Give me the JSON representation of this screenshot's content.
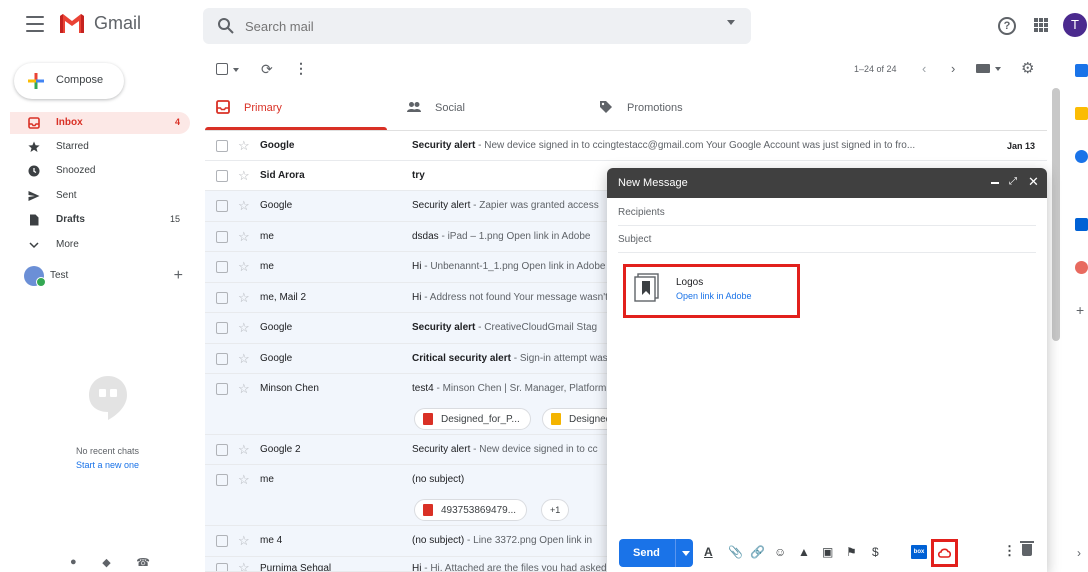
{
  "app": {
    "name": "Gmail",
    "avatar_letter": "T",
    "accent": "#d93025",
    "brand_blue": "#1a73e8"
  },
  "search": {
    "placeholder": "Search mail"
  },
  "sidebar": {
    "compose_label": "Compose",
    "items": [
      {
        "label": "Inbox",
        "count": "4",
        "icon": "inbox-icon",
        "active": true
      },
      {
        "label": "Starred",
        "count": "",
        "icon": "star-icon"
      },
      {
        "label": "Snoozed",
        "count": "",
        "icon": "clock-icon"
      },
      {
        "label": "Sent",
        "count": "",
        "icon": "send-icon"
      },
      {
        "label": "Drafts",
        "count": "15",
        "icon": "draft-icon"
      },
      {
        "label": "More",
        "count": "",
        "icon": "chevron-down-icon"
      }
    ],
    "account_label": "Test",
    "no_chats": "No recent chats",
    "start_new": "Start a new one"
  },
  "toolbar": {
    "page_count": "1–24 of 24"
  },
  "tabs": [
    {
      "label": "Primary",
      "icon": "inbox-icon"
    },
    {
      "label": "Social",
      "icon": "people-icon"
    },
    {
      "label": "Promotions",
      "icon": "tag-icon"
    }
  ],
  "emails": [
    {
      "sender": "Google",
      "subject": "Security alert",
      "snippet": " - New device signed in to ccingtestacc@gmail.com Your Google Account was just signed in to fro...",
      "date": "Jan 13",
      "unread": true
    },
    {
      "sender": "Sid Arora",
      "subject": "try",
      "snippet": "",
      "date": "",
      "unread": true
    },
    {
      "sender": "Google",
      "subject": "Security alert",
      "snippet": " - Zapier was granted access",
      "date": "",
      "unread": false
    },
    {
      "sender": "me",
      "subject": "dsdas",
      "snippet": " - iPad – 1.png Open link in Adobe",
      "date": "",
      "unread": false
    },
    {
      "sender": "me",
      "subject": "Hi",
      "snippet": " - Unbenannt-1_1.png Open link in Adobe",
      "date": "",
      "unread": false
    },
    {
      "sender": "me, Mail 2",
      "subject": "Hi",
      "snippet": " - Address not found Your message wasn't",
      "date": "",
      "unread": false
    },
    {
      "sender": "Google",
      "subject": "Security alert",
      "snippet": " - CreativeCloudGmail Stag",
      "date": "",
      "unread": false
    },
    {
      "sender": "Google",
      "subject": "Critical security alert",
      "snippet": " - Sign-in attempt was",
      "date": "",
      "unread": false
    },
    {
      "sender": "Minson Chen",
      "subject": "test4",
      "snippet": " - Minson Chen | Sr. Manager, Platform",
      "date": "",
      "unread": false,
      "chips": [
        "Designed_for_P...",
        "Designed"
      ]
    },
    {
      "sender": "Google 2",
      "subject": "Security alert",
      "snippet": " - New device signed in to cc",
      "date": "",
      "unread": false
    },
    {
      "sender": "me",
      "subject": "(no subject)",
      "snippet": "",
      "date": "",
      "unread": false,
      "chips": [
        "493753869479...",
        "+1"
      ]
    },
    {
      "sender": "me 4",
      "subject": "(no subject)",
      "snippet": " - Line 3372.png Open link in",
      "date": "",
      "unread": false
    },
    {
      "sender": "Purnima Sehgal",
      "subject": "Hi",
      "snippet": " - Hi, Attached are the files you had asked",
      "date": "",
      "unread": false
    }
  ],
  "compose_window": {
    "title": "New Message",
    "recipients_placeholder": "Recipients",
    "subject_placeholder": "Subject",
    "attachment_name": "Logos",
    "attachment_link": "Open link in Adobe",
    "send_label": "Send",
    "highlight_color": "#e2201c"
  }
}
